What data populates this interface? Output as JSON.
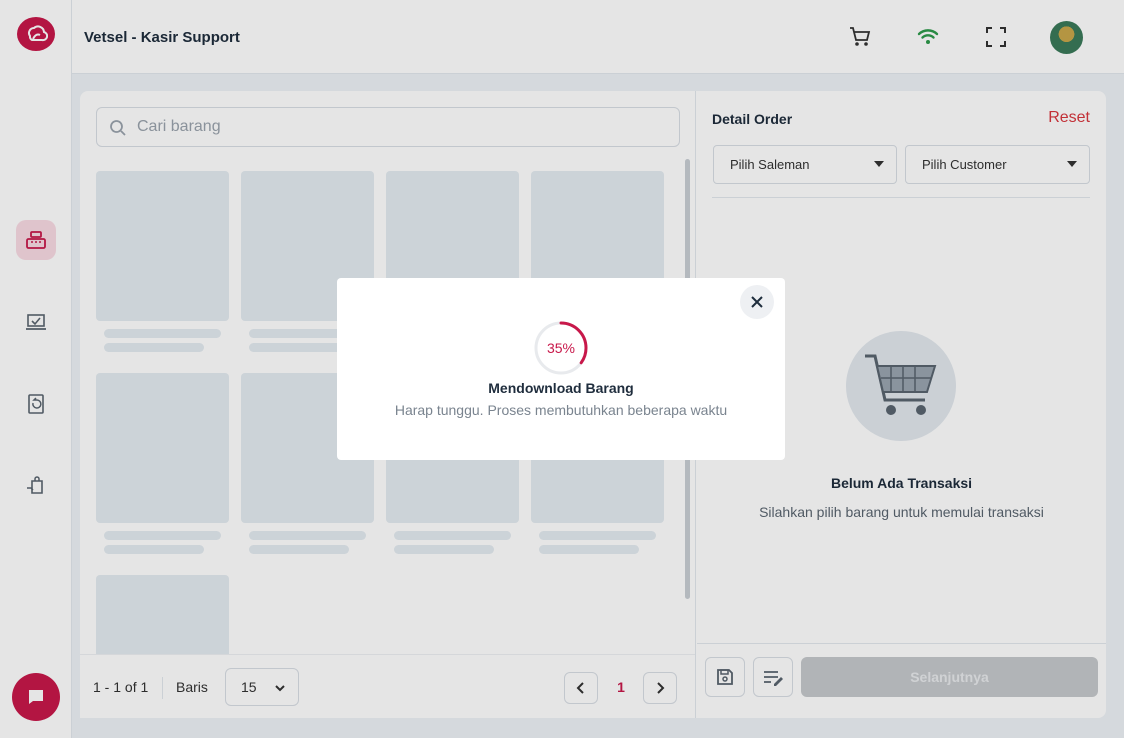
{
  "header": {
    "title": "Vetsel - Kasir Support",
    "icons": [
      "cart-icon",
      "wifi-icon",
      "fullscreen-icon"
    ]
  },
  "sidebar": {
    "items": [
      {
        "name": "cash-register-icon",
        "active": true
      },
      {
        "name": "laptop-check-icon",
        "active": false
      },
      {
        "name": "return-icon",
        "active": false
      },
      {
        "name": "shopping-bag-hand-icon",
        "active": false
      }
    ]
  },
  "search": {
    "placeholder": "Cari barang"
  },
  "pagination": {
    "range": "1 - 1 of 1",
    "rows_label": "Baris",
    "rows_value": "15",
    "current_page": "1"
  },
  "order": {
    "title": "Detail Order",
    "reset_label": "Reset",
    "saleman_placeholder": "Pilih Saleman",
    "customer_placeholder": "Pilih Customer",
    "empty_title": "Belum Ada Transaksi",
    "empty_subtitle": "Silahkan pilih barang untuk memulai transaksi",
    "next_label": "Selanjutnya"
  },
  "modal": {
    "progress": 35,
    "progress_label": "35%",
    "title": "Mendownload Barang",
    "subtitle": "Harap tunggu. Proses membutuhkan beberapa waktu"
  },
  "colors": {
    "accent": "#c8184a",
    "reset": "#d9363e",
    "skeleton": "#e4ebf1"
  }
}
